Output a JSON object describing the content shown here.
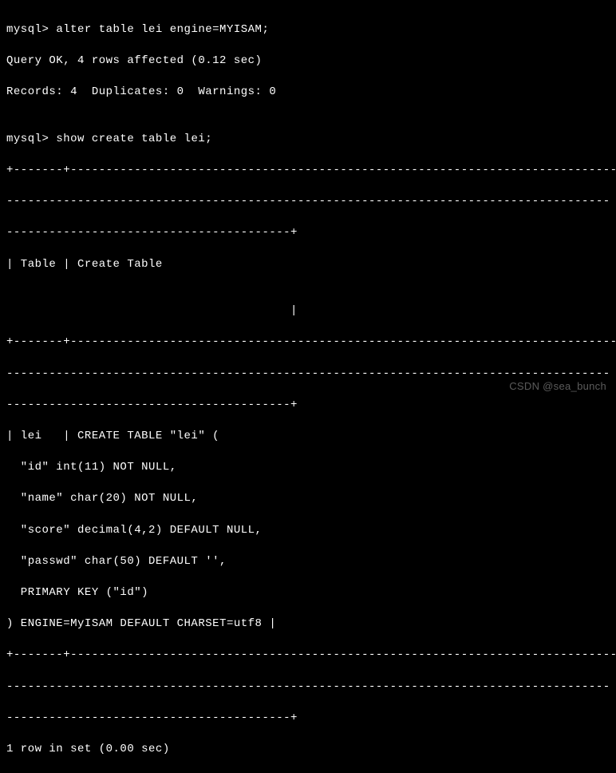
{
  "terminal": {
    "prompt1": "mysql> ",
    "command1": "alter table lei engine=MYISAM;",
    "result1_line1": "Query OK, 4 rows affected (0.12 sec)",
    "result1_line2": "Records: 4  Duplicates: 0  Warnings: 0",
    "blank1": "",
    "prompt2": "mysql> ",
    "command2": "show create table lei;",
    "border1": "+-------+-----------------------------------------------------------------------------",
    "border2": "-------------------------------------------------------------------------------------",
    "border3": "----------------------------------------+",
    "header_row": "| Table | Create Table",
    "header_blank": "",
    "header_end": "                                        |",
    "border4": "+-------+-----------------------------------------------------------------------------",
    "border5": "-------------------------------------------------------------------------------------",
    "border6": "----------------------------------------+",
    "data_line1": "| lei   | CREATE TABLE \"lei\" (",
    "data_line2": "  \"id\" int(11) NOT NULL,",
    "data_line3": "  \"name\" char(20) NOT NULL,",
    "data_line4": "  \"score\" decimal(4,2) DEFAULT NULL,",
    "data_line5": "  \"passwd\" char(50) DEFAULT '',",
    "data_line6": "  PRIMARY KEY (\"id\")",
    "data_line7": ") ENGINE=MyISAM DEFAULT CHARSET=utf8 |",
    "border7": "+-------+-----------------------------------------------------------------------------",
    "border8": "-------------------------------------------------------------------------------------",
    "border9": "----------------------------------------+",
    "footer": "1 row in set (0.00 sec)"
  },
  "watermark": "CSDN @sea_bunch",
  "chart_data": {
    "type": "table",
    "title": "show create table lei",
    "columns": [
      "Table",
      "Create Table"
    ],
    "rows": [
      {
        "Table": "lei",
        "Create Table": "CREATE TABLE \"lei\" (\n  \"id\" int(11) NOT NULL,\n  \"name\" char(20) NOT NULL,\n  \"score\" decimal(4,2) DEFAULT NULL,\n  \"passwd\" char(50) DEFAULT '',\n  PRIMARY KEY (\"id\")\n) ENGINE=MyISAM DEFAULT CHARSET=utf8"
      }
    ],
    "alter_command": "alter table lei engine=MYISAM",
    "alter_result": {
      "rows_affected": 4,
      "time_sec": 0.12,
      "records": 4,
      "duplicates": 0,
      "warnings": 0
    },
    "select_time_sec": 0.0,
    "rows_in_set": 1
  }
}
